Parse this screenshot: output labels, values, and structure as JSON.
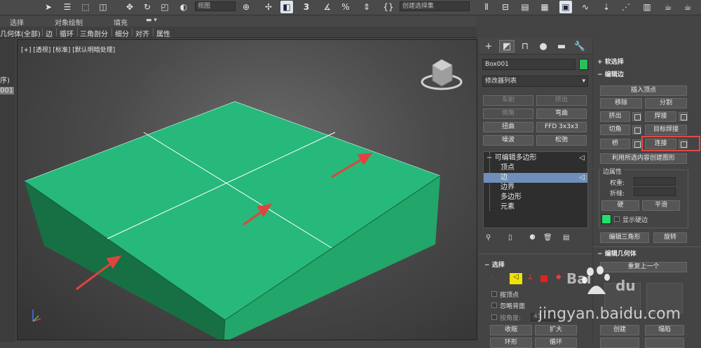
{
  "toolbar": {
    "view_dropdown": "视图",
    "selection_set": "创建选择集"
  },
  "ribbon": {
    "groups": [
      "选择",
      "对象绘制",
      "填充"
    ],
    "tabs": [
      "几何体(全部)",
      "边",
      "循环",
      "三角剖分",
      "细分",
      "对齐",
      "属性"
    ]
  },
  "left_panel": {
    "line1": "序)",
    "line2": "001"
  },
  "viewport": {
    "label": "[+] [透视] [标准] [默认明暗处理]"
  },
  "command_panel": {
    "object_name": "Box001",
    "object_color": "#27c05a",
    "modifier_list": "修改器列表",
    "modifier_buttons": [
      "车削",
      "挤出",
      "倒角",
      "弯曲",
      "扭曲",
      "FFD 3x3x3",
      "噪波",
      "松弛"
    ],
    "stack": {
      "root": "可编辑多边形",
      "children": [
        "顶点",
        "边",
        "边界",
        "多边形",
        "元素"
      ],
      "selected": "边"
    },
    "selection_rollout": {
      "title": "选择",
      "options": [
        "按顶点",
        "忽略背面",
        "按角度:"
      ],
      "angle_value": "45",
      "buttons": [
        "收缩",
        "扩大",
        "环形",
        "循环"
      ]
    }
  },
  "edit_panel": {
    "soft_selection": "软选择",
    "edit_edges": "编辑边",
    "buttons": {
      "insert_vertex": "插入顶点",
      "remove": "移除",
      "split": "分割",
      "extrude": "挤出",
      "weld": "焊接",
      "chamfer": "切角",
      "target_weld": "目标焊接",
      "bridge": "桥",
      "connect": "连接",
      "create_shape": "利用所选内容创建图形",
      "hard": "硬",
      "smooth": "平滑",
      "edit_tri": "编辑三角形",
      "turn": "旋转"
    },
    "edge_attributes": "边属性",
    "weight_label": "权重:",
    "crease_label": "折缝:",
    "show_hard_edges": "显示硬边",
    "hard_edge_color": "#21e06a",
    "edit_geometry": "编辑几何体",
    "repeat_last": "重复上一个",
    "create": "创建",
    "collapse": "塌陷"
  },
  "watermark": {
    "brand": "Bai",
    "brand2": "du",
    "url": "jingyan.baidu.com"
  },
  "colors": {
    "box_top": "#26b57a",
    "box_front": "#1f8a58",
    "box_left": "#17673f",
    "arrow": "#e0443e",
    "highlight": "#e24848"
  }
}
